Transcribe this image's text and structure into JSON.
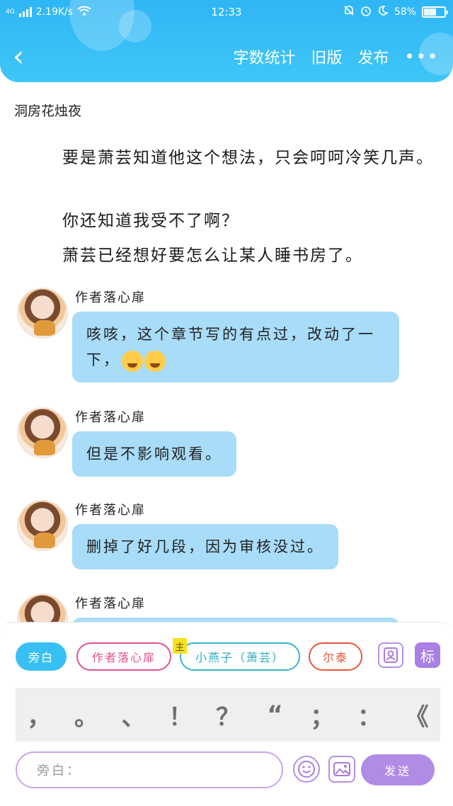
{
  "status_bar": {
    "network": "4G",
    "speed": "2.19K/s",
    "time": "12:33",
    "battery": "58%",
    "battery_level": 0.58,
    "icons": [
      "signal-icon",
      "wifi-icon",
      "bell-mute-icon",
      "alarm-icon",
      "moon-icon",
      "battery-icon"
    ]
  },
  "header": {
    "back_icon": "‹",
    "actions": {
      "word_count": "字数统计",
      "old_version": "旧版",
      "publish": "发布",
      "more": "•••"
    },
    "accent_color": "#2fb6f5"
  },
  "chapter": {
    "title": "洞房花烛夜"
  },
  "paragraphs": [
    "要是萧芸知道他这个想法，只会呵呵冷笑几声。",
    "你还知道我受不了啊？",
    "萧芸已经想好要怎么让某人睡书房了。"
  ],
  "messages": [
    {
      "author": "作者落心扉",
      "text": "咳咳，这个章节写的有点过，改动了一下，",
      "emojis": [
        "laugh-cry-emoji",
        "crying-emoji"
      ]
    },
    {
      "author": "作者落心扉",
      "text": "但是不影响观看。"
    },
    {
      "author": "作者落心扉",
      "text": "删掉了好几段，因为审核没过。"
    },
    {
      "author": "作者落心扉",
      "text": ""
    }
  ],
  "roles": {
    "narration": "旁白",
    "author": "作者落心扉",
    "main_tag": "主",
    "main": "小燕子（萧芸）",
    "er": "尔泰",
    "tag_button": "标"
  },
  "punctuation": [
    "，",
    "。",
    "、",
    "！",
    "？",
    "“",
    "；",
    "：",
    "《"
  ],
  "input": {
    "placeholder": "旁白：",
    "send": "发送"
  }
}
